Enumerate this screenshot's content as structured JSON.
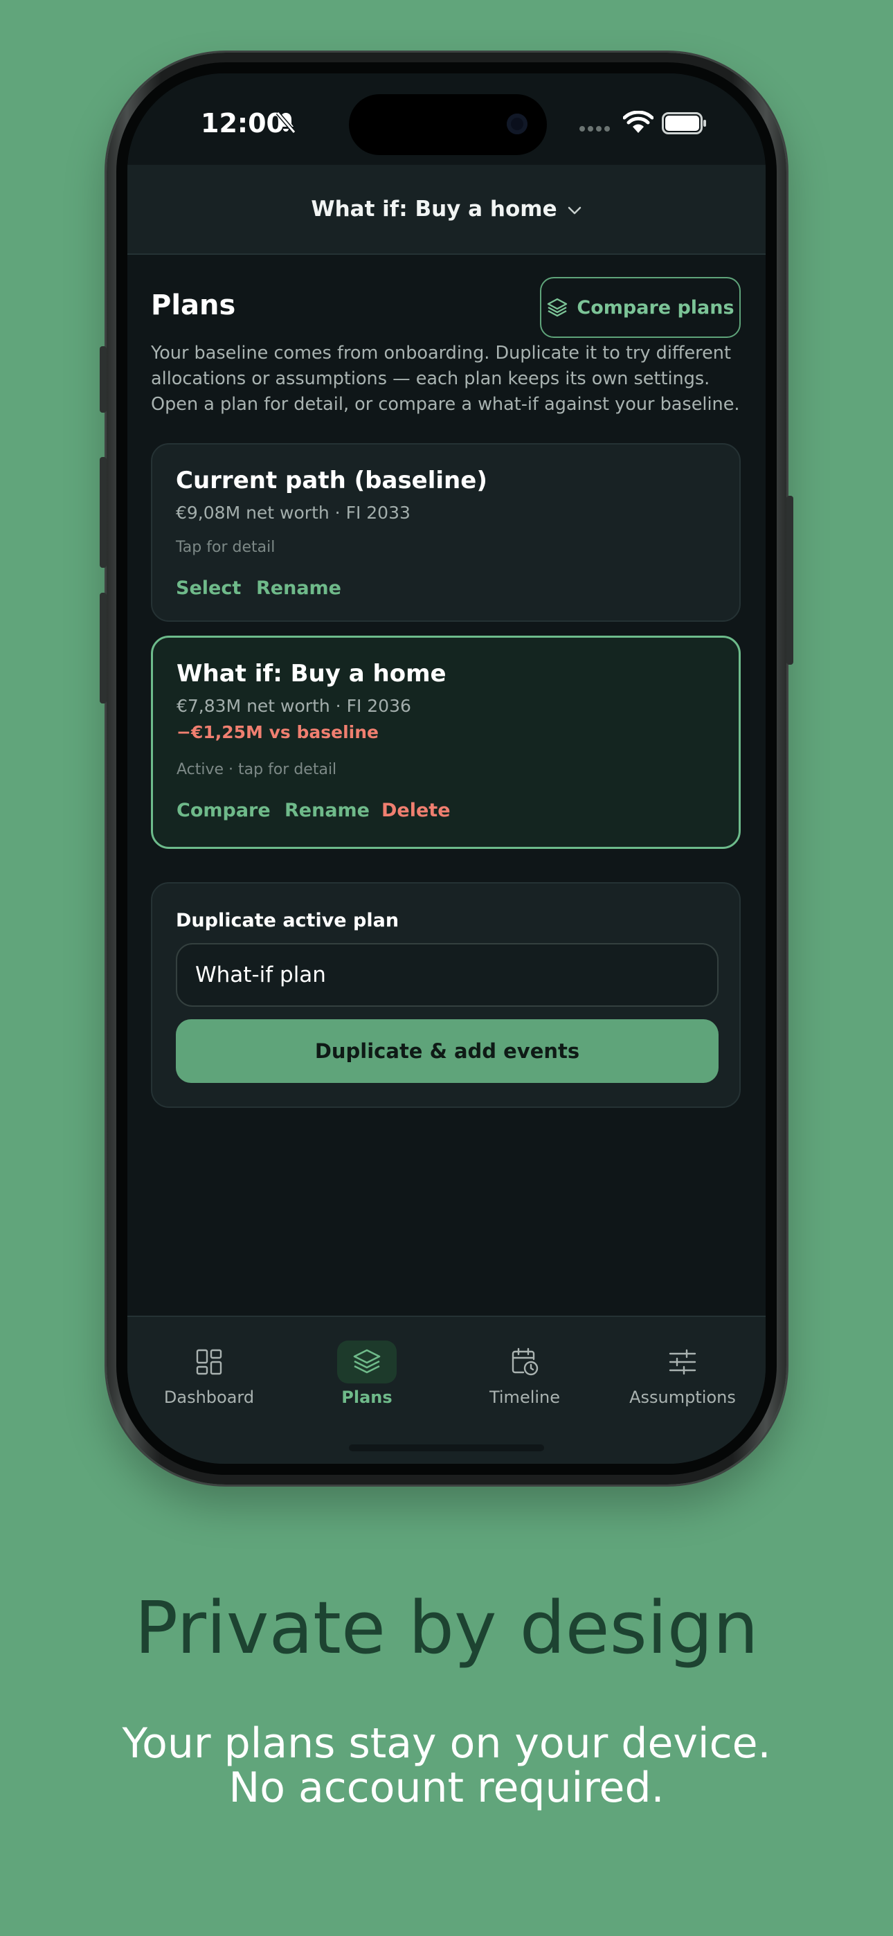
{
  "status_bar": {
    "time": "12:00"
  },
  "header": {
    "title": "What if: Buy a home"
  },
  "plans": {
    "title": "Plans",
    "compare_button": "Compare plans",
    "description": "Your baseline comes from onboarding. Duplicate it to try different allocations or assumptions — each plan keeps its own settings. Open a plan for detail, or compare a what-if against your baseline."
  },
  "cards": [
    {
      "title": "Current path (baseline)",
      "summary": "€9,08M net worth · FI 2033",
      "note": "Tap for detail",
      "actions": [
        "Select",
        "Rename"
      ]
    },
    {
      "title": "What if: Buy a home",
      "summary": "€7,83M net worth · FI 2036",
      "delta": "−€1,25M vs baseline",
      "note": "Active · tap for detail",
      "actions": [
        "Compare",
        "Rename",
        "Delete"
      ]
    }
  ],
  "duplicate": {
    "label": "Duplicate active plan",
    "input_value": "What-if plan",
    "button": "Duplicate & add events"
  },
  "tabs": [
    {
      "label": "Dashboard",
      "icon": "grid-icon",
      "active": false
    },
    {
      "label": "Plans",
      "icon": "layers-icon",
      "active": true
    },
    {
      "label": "Timeline",
      "icon": "calendar-clock-icon",
      "active": false
    },
    {
      "label": "Assumptions",
      "icon": "sliders-icon",
      "active": false
    }
  ],
  "marketing": {
    "headline": "Private by design",
    "subline_1": "Your plans stay on your device.",
    "subline_2": "No account required."
  },
  "colors": {
    "background": "#61a57b",
    "accent": "#6fba8a",
    "negative": "#f07f70",
    "screen": "#0f1618"
  }
}
